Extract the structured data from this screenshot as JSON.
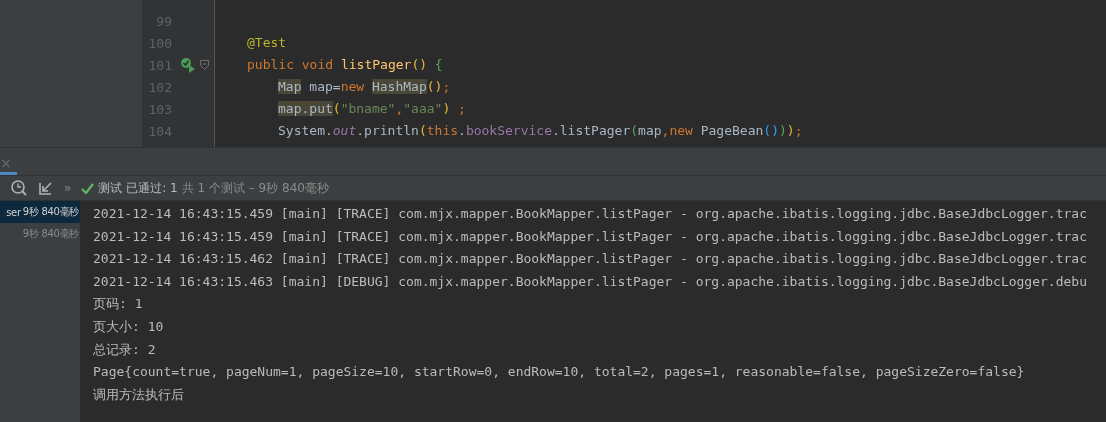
{
  "editor": {
    "lines": [
      {
        "number": "99",
        "runnable": false,
        "fold": false
      },
      {
        "number": "100",
        "runnable": false,
        "fold": false,
        "indented": false,
        "tokens": [
          {
            "text": "@Test",
            "kind": "annotation"
          }
        ]
      },
      {
        "number": "101",
        "runnable": true,
        "fold": true,
        "indented": false,
        "tokens": [
          {
            "text": "public void ",
            "kind": "keyword"
          },
          {
            "text": "listPager",
            "kind": "method"
          },
          {
            "text": "()",
            "kind": "paren"
          },
          {
            "text": " {",
            "kind": "brace"
          }
        ]
      },
      {
        "number": "102",
        "runnable": false,
        "fold": false,
        "indented": true,
        "tokens": [
          {
            "text": "Map",
            "kind": "plain",
            "highlighted": true
          },
          {
            "text": " map=",
            "kind": "plain"
          },
          {
            "text": "new ",
            "kind": "keyword"
          },
          {
            "text": "HashMap",
            "kind": "plain",
            "highlighted": true
          },
          {
            "text": "()",
            "kind": "paren"
          },
          {
            "text": ";",
            "kind": "keyword"
          }
        ]
      },
      {
        "number": "103",
        "runnable": false,
        "fold": false,
        "indented": true,
        "tokens": [
          {
            "text": "map.put",
            "kind": "plain",
            "highlighted": true
          },
          {
            "text": "(",
            "kind": "paren"
          },
          {
            "text": "\"bname\"",
            "kind": "string"
          },
          {
            "text": ",",
            "kind": "keyword"
          },
          {
            "text": "\"aaa\"",
            "kind": "string"
          },
          {
            "text": ")",
            "kind": "paren"
          },
          {
            "text": " ;",
            "kind": "keyword"
          }
        ]
      },
      {
        "number": "104",
        "runnable": false,
        "fold": false,
        "indented": true,
        "tokens": [
          {
            "text": "System.",
            "kind": "plain"
          },
          {
            "text": "out",
            "kind": "static-field"
          },
          {
            "text": ".println",
            "kind": "plain"
          },
          {
            "text": "(",
            "kind": "paren"
          },
          {
            "text": "this",
            "kind": "keyword"
          },
          {
            "text": ".",
            "kind": "plain"
          },
          {
            "text": "bookService",
            "kind": "field"
          },
          {
            "text": ".listPager",
            "kind": "plain"
          },
          {
            "text": "(",
            "kind": "paren2"
          },
          {
            "text": "map",
            "kind": "plain"
          },
          {
            "text": ",",
            "kind": "keyword"
          },
          {
            "text": "new ",
            "kind": "keyword"
          },
          {
            "text": "PageBean",
            "kind": "plain"
          },
          {
            "text": "()",
            "kind": "paren3"
          },
          {
            "text": ")",
            "kind": "paren2"
          },
          {
            "text": ")",
            "kind": "paren"
          },
          {
            "text": ";",
            "kind": "keyword"
          }
        ]
      }
    ]
  },
  "run_panel": {
    "tab_close": "×",
    "status": {
      "passed": "测试 已通过: 1",
      "summary": "共 1 个测试 – 9秒 840毫秒"
    },
    "more": "»",
    "tree": [
      {
        "name": "ser",
        "time": "9秒 840毫秒",
        "selected": true
      },
      {
        "time": "9秒 840毫秒",
        "selected": false
      }
    ],
    "console": [
      "2021-12-14 16:43:15.459 [main] [TRACE] com.mjx.mapper.BookMapper.listPager - org.apache.ibatis.logging.jdbc.BaseJdbcLogger.trac",
      "2021-12-14 16:43:15.459 [main] [TRACE] com.mjx.mapper.BookMapper.listPager - org.apache.ibatis.logging.jdbc.BaseJdbcLogger.trac",
      "2021-12-14 16:43:15.462 [main] [TRACE] com.mjx.mapper.BookMapper.listPager - org.apache.ibatis.logging.jdbc.BaseJdbcLogger.trac",
      "2021-12-14 16:43:15.463 [main] [DEBUG] com.mjx.mapper.BookMapper.listPager - org.apache.ibatis.logging.jdbc.BaseJdbcLogger.debu",
      "页码: 1",
      "页大小: 10",
      "总记录: 2",
      "Page{count=true, pageNum=1, pageSize=10, startRow=0, endRow=10, total=2, pages=1, reasonable=false, pageSizeZero=false}",
      "调用方法执行后"
    ]
  }
}
